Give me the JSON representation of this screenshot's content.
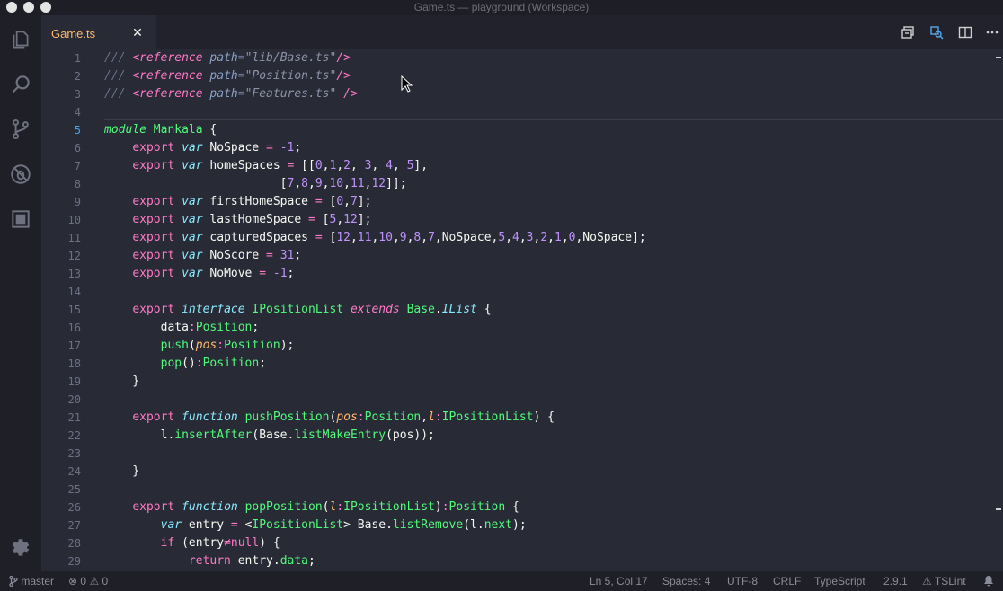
{
  "window": {
    "title": "Game.ts — playground (Workspace)"
  },
  "tab": {
    "label": "Game.ts",
    "close_glyph": "✕"
  },
  "activity_bar": [
    "files-icon",
    "search-icon",
    "source-control-icon",
    "debug-icon",
    "extensions-icon",
    "gear-icon"
  ],
  "tab_actions": [
    "open-changes-icon",
    "preview-icon",
    "split-editor-icon",
    "more-icon"
  ],
  "editor": {
    "active_line": 5,
    "lines": [
      {
        "n": "1",
        "tokens": [
          [
            "c-comment",
            "/// "
          ],
          [
            "c-tag",
            "<reference"
          ],
          [
            "c-comment",
            " "
          ],
          [
            "c-attr",
            "path"
          ],
          [
            "c-comment",
            "="
          ],
          [
            "c-str",
            "\"lib/Base.ts\""
          ],
          [
            "c-tag",
            "/>"
          ]
        ]
      },
      {
        "n": "2",
        "tokens": [
          [
            "c-comment",
            "/// "
          ],
          [
            "c-tag",
            "<reference"
          ],
          [
            "c-comment",
            " "
          ],
          [
            "c-attr",
            "path"
          ],
          [
            "c-comment",
            "="
          ],
          [
            "c-str",
            "\"Position.ts\""
          ],
          [
            "c-tag",
            "/>"
          ]
        ]
      },
      {
        "n": "3",
        "tokens": [
          [
            "c-comment",
            "/// "
          ],
          [
            "c-tag",
            "<reference"
          ],
          [
            "c-comment",
            " "
          ],
          [
            "c-attr",
            "path"
          ],
          [
            "c-comment",
            "="
          ],
          [
            "c-str",
            "\"Features.ts\""
          ],
          [
            "c-comment",
            " "
          ],
          [
            "c-tag",
            "/>"
          ]
        ]
      },
      {
        "n": "4",
        "tokens": []
      },
      {
        "n": "5",
        "tokens": [
          [
            "c-kwm",
            "module"
          ],
          [
            "c-default",
            " "
          ],
          [
            "c-type",
            "Mankala"
          ],
          [
            "c-default",
            " "
          ],
          [
            "c-punc",
            "{"
          ]
        ]
      },
      {
        "n": "6",
        "tokens": [
          [
            "c-default",
            "    "
          ],
          [
            "c-kw",
            "export"
          ],
          [
            "c-default",
            " "
          ],
          [
            "c-kwi",
            "var"
          ],
          [
            "c-default",
            " NoSpace "
          ],
          [
            "c-op",
            "="
          ],
          [
            "c-default",
            " "
          ],
          [
            "c-num",
            "-1"
          ],
          [
            "c-punc",
            ";"
          ]
        ]
      },
      {
        "n": "7",
        "tokens": [
          [
            "c-default",
            "    "
          ],
          [
            "c-kw",
            "export"
          ],
          [
            "c-default",
            " "
          ],
          [
            "c-kwi",
            "var"
          ],
          [
            "c-default",
            " homeSpaces "
          ],
          [
            "c-op",
            "="
          ],
          [
            "c-default",
            " [["
          ],
          [
            "c-num",
            "0"
          ],
          [
            "c-default",
            ","
          ],
          [
            "c-num",
            "1"
          ],
          [
            "c-default",
            ","
          ],
          [
            "c-num",
            "2"
          ],
          [
            "c-default",
            ", "
          ],
          [
            "c-num",
            "3"
          ],
          [
            "c-default",
            ", "
          ],
          [
            "c-num",
            "4"
          ],
          [
            "c-default",
            ", "
          ],
          [
            "c-num",
            "5"
          ],
          [
            "c-default",
            "],"
          ]
        ]
      },
      {
        "n": "8",
        "tokens": [
          [
            "c-default",
            "                         ["
          ],
          [
            "c-num",
            "7"
          ],
          [
            "c-default",
            ","
          ],
          [
            "c-num",
            "8"
          ],
          [
            "c-default",
            ","
          ],
          [
            "c-num",
            "9"
          ],
          [
            "c-default",
            ","
          ],
          [
            "c-num",
            "10"
          ],
          [
            "c-default",
            ","
          ],
          [
            "c-num",
            "11"
          ],
          [
            "c-default",
            ","
          ],
          [
            "c-num",
            "12"
          ],
          [
            "c-default",
            "]];"
          ]
        ]
      },
      {
        "n": "9",
        "tokens": [
          [
            "c-default",
            "    "
          ],
          [
            "c-kw",
            "export"
          ],
          [
            "c-default",
            " "
          ],
          [
            "c-kwi",
            "var"
          ],
          [
            "c-default",
            " firstHomeSpace "
          ],
          [
            "c-op",
            "="
          ],
          [
            "c-default",
            " ["
          ],
          [
            "c-num",
            "0"
          ],
          [
            "c-default",
            ","
          ],
          [
            "c-num",
            "7"
          ],
          [
            "c-default",
            "];"
          ]
        ]
      },
      {
        "n": "10",
        "tokens": [
          [
            "c-default",
            "    "
          ],
          [
            "c-kw",
            "export"
          ],
          [
            "c-default",
            " "
          ],
          [
            "c-kwi",
            "var"
          ],
          [
            "c-default",
            " lastHomeSpace "
          ],
          [
            "c-op",
            "="
          ],
          [
            "c-default",
            " ["
          ],
          [
            "c-num",
            "5"
          ],
          [
            "c-default",
            ","
          ],
          [
            "c-num",
            "12"
          ],
          [
            "c-default",
            "];"
          ]
        ]
      },
      {
        "n": "11",
        "tokens": [
          [
            "c-default",
            "    "
          ],
          [
            "c-kw",
            "export"
          ],
          [
            "c-default",
            " "
          ],
          [
            "c-kwi",
            "var"
          ],
          [
            "c-default",
            " capturedSpaces "
          ],
          [
            "c-op",
            "="
          ],
          [
            "c-default",
            " ["
          ],
          [
            "c-num",
            "12"
          ],
          [
            "c-default",
            ","
          ],
          [
            "c-num",
            "11"
          ],
          [
            "c-default",
            ","
          ],
          [
            "c-num",
            "10"
          ],
          [
            "c-default",
            ","
          ],
          [
            "c-num",
            "9"
          ],
          [
            "c-default",
            ","
          ],
          [
            "c-num",
            "8"
          ],
          [
            "c-default",
            ","
          ],
          [
            "c-num",
            "7"
          ],
          [
            "c-default",
            ",NoSpace,"
          ],
          [
            "c-num",
            "5"
          ],
          [
            "c-default",
            ","
          ],
          [
            "c-num",
            "4"
          ],
          [
            "c-default",
            ","
          ],
          [
            "c-num",
            "3"
          ],
          [
            "c-default",
            ","
          ],
          [
            "c-num",
            "2"
          ],
          [
            "c-default",
            ","
          ],
          [
            "c-num",
            "1"
          ],
          [
            "c-default",
            ","
          ],
          [
            "c-num",
            "0"
          ],
          [
            "c-default",
            ",NoSpace];"
          ]
        ]
      },
      {
        "n": "12",
        "tokens": [
          [
            "c-default",
            "    "
          ],
          [
            "c-kw",
            "export"
          ],
          [
            "c-default",
            " "
          ],
          [
            "c-kwi",
            "var"
          ],
          [
            "c-default",
            " NoScore "
          ],
          [
            "c-op",
            "="
          ],
          [
            "c-default",
            " "
          ],
          [
            "c-num",
            "31"
          ],
          [
            "c-punc",
            ";"
          ]
        ]
      },
      {
        "n": "13",
        "tokens": [
          [
            "c-default",
            "    "
          ],
          [
            "c-kw",
            "export"
          ],
          [
            "c-default",
            " "
          ],
          [
            "c-kwi",
            "var"
          ],
          [
            "c-default",
            " NoMove "
          ],
          [
            "c-op",
            "="
          ],
          [
            "c-default",
            " "
          ],
          [
            "c-num",
            "-1"
          ],
          [
            "c-punc",
            ";"
          ]
        ]
      },
      {
        "n": "14",
        "tokens": []
      },
      {
        "n": "15",
        "tokens": [
          [
            "c-default",
            "    "
          ],
          [
            "c-kw",
            "export"
          ],
          [
            "c-default",
            " "
          ],
          [
            "c-kwi",
            "interface"
          ],
          [
            "c-default",
            " "
          ],
          [
            "c-type",
            "IPositionList"
          ],
          [
            "c-default",
            " "
          ],
          [
            "c-ext",
            "extends"
          ],
          [
            "c-default",
            " "
          ],
          [
            "c-type",
            "Base"
          ],
          [
            "c-default",
            "."
          ],
          [
            "c-ilist",
            "IList"
          ],
          [
            "c-default",
            " {"
          ]
        ]
      },
      {
        "n": "16",
        "tokens": [
          [
            "c-default",
            "        data"
          ],
          [
            "c-op",
            ":"
          ],
          [
            "c-type",
            "Position"
          ],
          [
            "c-default",
            ";"
          ]
        ]
      },
      {
        "n": "17",
        "tokens": [
          [
            "c-default",
            "        "
          ],
          [
            "c-fn",
            "push"
          ],
          [
            "c-default",
            "("
          ],
          [
            "c-param",
            "pos"
          ],
          [
            "c-op",
            ":"
          ],
          [
            "c-type",
            "Position"
          ],
          [
            "c-default",
            ");"
          ]
        ]
      },
      {
        "n": "18",
        "tokens": [
          [
            "c-default",
            "        "
          ],
          [
            "c-fn",
            "pop"
          ],
          [
            "c-default",
            "()"
          ],
          [
            "c-op",
            ":"
          ],
          [
            "c-type",
            "Position"
          ],
          [
            "c-default",
            ";"
          ]
        ]
      },
      {
        "n": "19",
        "tokens": [
          [
            "c-default",
            "    }"
          ]
        ]
      },
      {
        "n": "20",
        "tokens": []
      },
      {
        "n": "21",
        "tokens": [
          [
            "c-default",
            "    "
          ],
          [
            "c-kw",
            "export"
          ],
          [
            "c-default",
            " "
          ],
          [
            "c-kwi",
            "function"
          ],
          [
            "c-default",
            " "
          ],
          [
            "c-fn",
            "pushPosition"
          ],
          [
            "c-default",
            "("
          ],
          [
            "c-param",
            "pos"
          ],
          [
            "c-op",
            ":"
          ],
          [
            "c-type",
            "Position"
          ],
          [
            "c-default",
            ","
          ],
          [
            "c-param",
            "l"
          ],
          [
            "c-op",
            ":"
          ],
          [
            "c-type",
            "IPositionList"
          ],
          [
            "c-default",
            ") {"
          ]
        ]
      },
      {
        "n": "22",
        "tokens": [
          [
            "c-default",
            "        l."
          ],
          [
            "c-fn",
            "insertAfter"
          ],
          [
            "c-default",
            "(Base."
          ],
          [
            "c-fn",
            "listMakeEntry"
          ],
          [
            "c-default",
            "(pos));"
          ]
        ]
      },
      {
        "n": "23",
        "tokens": []
      },
      {
        "n": "24",
        "tokens": [
          [
            "c-default",
            "    }"
          ]
        ]
      },
      {
        "n": "25",
        "tokens": []
      },
      {
        "n": "26",
        "tokens": [
          [
            "c-default",
            "    "
          ],
          [
            "c-kw",
            "export"
          ],
          [
            "c-default",
            " "
          ],
          [
            "c-kwi",
            "function"
          ],
          [
            "c-default",
            " "
          ],
          [
            "c-fn",
            "popPosition"
          ],
          [
            "c-default",
            "("
          ],
          [
            "c-param",
            "l"
          ],
          [
            "c-op",
            ":"
          ],
          [
            "c-type",
            "IPositionList"
          ],
          [
            "c-default",
            ")"
          ],
          [
            "c-op",
            ":"
          ],
          [
            "c-type",
            "Position"
          ],
          [
            "c-default",
            " {"
          ]
        ]
      },
      {
        "n": "27",
        "tokens": [
          [
            "c-default",
            "        "
          ],
          [
            "c-kwi",
            "var"
          ],
          [
            "c-default",
            " entry "
          ],
          [
            "c-op",
            "="
          ],
          [
            "c-default",
            " <"
          ],
          [
            "c-type",
            "IPositionList"
          ],
          [
            "c-default",
            "> Base."
          ],
          [
            "c-fn",
            "listRemove"
          ],
          [
            "c-default",
            "(l."
          ],
          [
            "c-fn",
            "next"
          ],
          [
            "c-default",
            ");"
          ]
        ]
      },
      {
        "n": "28",
        "tokens": [
          [
            "c-default",
            "        "
          ],
          [
            "c-kw",
            "if"
          ],
          [
            "c-default",
            " (entry"
          ],
          [
            "c-op",
            "≠"
          ],
          [
            "c-kw",
            "null"
          ],
          [
            "c-default",
            ") {"
          ]
        ]
      },
      {
        "n": "29",
        "tokens": [
          [
            "c-default",
            "            "
          ],
          [
            "c-kw",
            "return"
          ],
          [
            "c-default",
            " entry."
          ],
          [
            "c-fn",
            "data"
          ],
          [
            "c-default",
            ";"
          ]
        ]
      }
    ]
  },
  "status": {
    "branch": "master",
    "errors": "0",
    "warnings": "0",
    "position": "Ln 5, Col 17",
    "spaces": "Spaces: 4",
    "encoding": "UTF-8",
    "eol": "CRLF",
    "language": "TypeScript",
    "version": "2.9.1",
    "linter": "TSLint"
  }
}
